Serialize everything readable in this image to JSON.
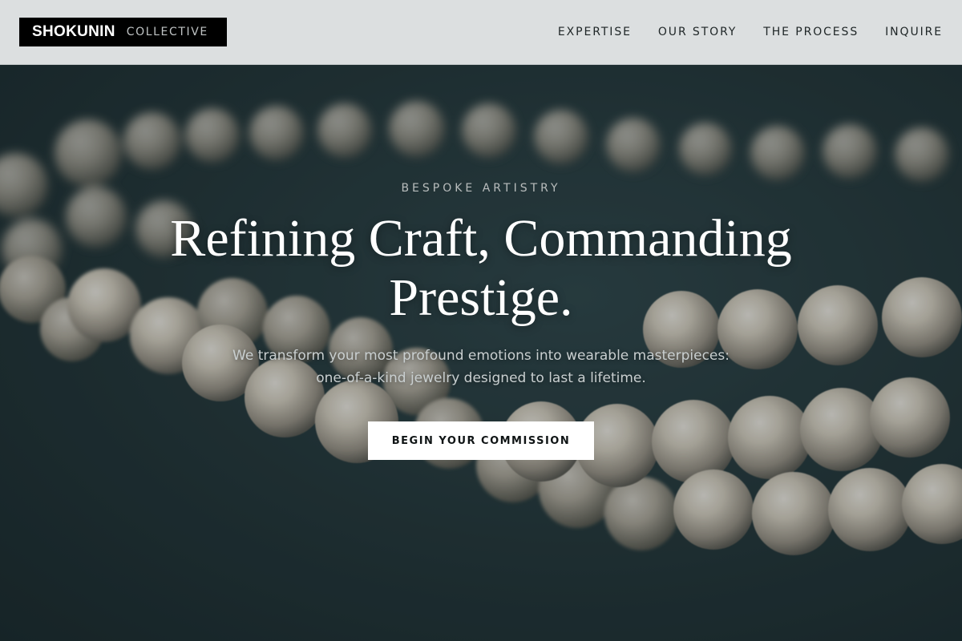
{
  "brand": {
    "name": "SHOKUNIN",
    "tagline": "COLLECTIVE"
  },
  "nav": {
    "items": [
      {
        "label": "EXPERTISE"
      },
      {
        "label": "OUR STORY"
      },
      {
        "label": "THE PROCESS"
      },
      {
        "label": "INQUIRE"
      }
    ]
  },
  "hero": {
    "eyebrow": "BESPOKE ARTISTRY",
    "headline_line1": "Refining Craft, Commanding",
    "headline_line2": "Prestige.",
    "subtext_line1": "We transform your most profound emotions into wearable masterpieces:",
    "subtext_line2": "one-of-a-kind jewelry designed to last a lifetime.",
    "cta_label": "BEGIN YOUR COMMISSION",
    "background_image": "pearl-necklace-photo"
  },
  "colors": {
    "header_bg": "#dcdfe0",
    "logo_bg": "#000000",
    "hero_bg": "#233639",
    "cta_bg": "#ffffff",
    "text_light": "#ffffff"
  }
}
